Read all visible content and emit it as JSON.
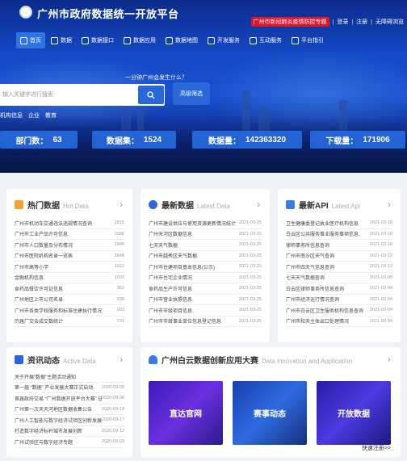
{
  "header": {
    "site_title": "广州市政府数据统一开放平台",
    "special_link": "广州市新冠肺炎疫情防控专题",
    "login": "登录",
    "register": "注册",
    "accessibility": "无障碍浏览"
  },
  "nav": [
    {
      "label": "首页",
      "icon": "home-icon"
    },
    {
      "label": "数据",
      "icon": "data-icon"
    },
    {
      "label": "数据接口",
      "icon": "api-icon"
    },
    {
      "label": "数据应用",
      "icon": "app-icon"
    },
    {
      "label": "数据地图",
      "icon": "map-icon"
    },
    {
      "label": "开发服务",
      "icon": "dev-icon"
    },
    {
      "label": "互动服务",
      "icon": "chat-icon"
    },
    {
      "label": "平台指引",
      "icon": "guide-icon"
    }
  ],
  "search": {
    "subheading": "一分钟广州会发生什么？",
    "placeholder": "输入关键字进行搜索",
    "advanced_label": "高级筛选",
    "hotwords": [
      "机构信息",
      "企业",
      "教育"
    ]
  },
  "stats": [
    {
      "label": "部门数：",
      "value": "63"
    },
    {
      "label": "数据集：",
      "value": "1524"
    },
    {
      "label": "数据量：",
      "value": "142363320"
    },
    {
      "label": "下载量：",
      "value": "171906"
    }
  ],
  "hot_data": {
    "title": "热门数据",
    "subtitle": "Hot Data",
    "items": [
      {
        "title": "广州市机动车交通违法违规情况查询",
        "count": "2815"
      },
      {
        "title": "广州市工业产品许可信息",
        "count": "2058"
      },
      {
        "title": "广州市人口数量及分布情况",
        "count": "1945"
      },
      {
        "title": "广州市医院机构名录一览表",
        "count": "1848"
      },
      {
        "title": "广州市高等小学",
        "count": "1012"
      },
      {
        "title": "金融机构信息",
        "count": "1003"
      },
      {
        "title": "食药品餐饮许可证信息",
        "count": "952"
      },
      {
        "title": "广州地区上市公司名录",
        "count": "938"
      },
      {
        "title": "广州市各类学校服务和标准住建执行情况",
        "count": "903"
      },
      {
        "title": "历届广交会成交数统计",
        "count": "731"
      }
    ]
  },
  "latest_data": {
    "title": "最新数据",
    "subtitle": "Latest Data",
    "items": [
      {
        "title": "广州市建设供应与使用资源更新情况统计",
        "date": "2021-03-25"
      },
      {
        "title": "广州天河区数据信息",
        "date": "2021-03-25"
      },
      {
        "title": "七天天气数据",
        "date": "2021-03-25"
      },
      {
        "title": "广州市越秀区天气数据",
        "date": "2021-03-25"
      },
      {
        "title": "广州市住建项目基本信息(公示)",
        "date": "2021-03-25"
      },
      {
        "title": "广州市住宅企业情况",
        "date": "2021-03-25"
      },
      {
        "title": "食药品生产许可信息",
        "date": "2021-03-25"
      },
      {
        "title": "广州市营业执照信息",
        "date": "2021-03-25"
      },
      {
        "title": "广州市市级项目信息",
        "date": "2021-03-25"
      },
      {
        "title": "广州市市级事业单位信息登记信息",
        "date": "2021-03-25"
      }
    ]
  },
  "latest_api": {
    "title": "最新API",
    "subtitle": "Latest Api",
    "items": [
      {
        "title": "卫生健康委登记执业医疗机构信息",
        "date": "2021-03-18"
      },
      {
        "title": "白云区公共服务事业服务事项信息",
        "date": "2021-03-18"
      },
      {
        "title": "律师事务所信息查询",
        "date": "2021-03-18"
      },
      {
        "title": "广州市南沙区天气查询",
        "date": "2021-03-12"
      },
      {
        "title": "广州市四天气信息查询",
        "date": "2021-03-12"
      },
      {
        "title": "七天天气数据查询",
        "date": "2021-03-05"
      },
      {
        "title": "白云区律师事务所信息查询",
        "date": "2021-03-04"
      },
      {
        "title": "广州市经济运行情况查询",
        "date": "2021-03-04"
      },
      {
        "title": "广州市白云区卫生服务机构信息查询",
        "date": "2021-03-04"
      },
      {
        "title": "广州市和天主体出口处理情况",
        "date": "2021-03-04"
      }
    ]
  },
  "news": {
    "title": "资讯动态",
    "subtitle": "Active Data",
    "items": [
      {
        "title": "关于开展“数据”主题活动通知",
        "date": ""
      },
      {
        "title": "第一届 “数据” 产业发展大赛正式启动",
        "date": "2020-09-08"
      },
      {
        "title": "首届政府交易 “广州数据开放平台大赛” 征集通知",
        "date": "2020-09-08"
      },
      {
        "title": "广州第一次天天河地区数据收集公告",
        "date": "2020-09-19"
      },
      {
        "title": "广州人工智能与数字经济试验区创新发展",
        "date": "2020-09-17"
      },
      {
        "title": "打造数字经济标杆城市发展创新",
        "date": "2020-09-12"
      },
      {
        "title": "广州试验区与数字经济专题",
        "date": "2020-09-03"
      }
    ]
  },
  "innovation": {
    "title": "广州白云数据创新应用大赛",
    "subtitle": "Data innovation and Application",
    "cards": [
      "直达官网",
      "赛事动态",
      "开放数据"
    ],
    "more": "快速注册>>"
  },
  "colors": {
    "primary": "#2a68d9",
    "accent_red": "#e3142a",
    "hot_icon": "#f2a23a",
    "latest_icon": "#2a68d9",
    "api_icon": "#3b7be0"
  }
}
